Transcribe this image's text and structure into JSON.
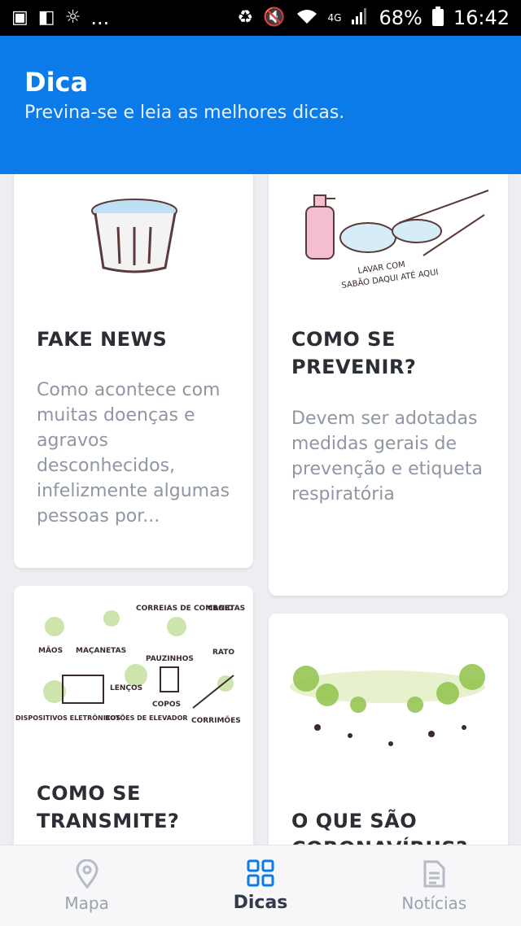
{
  "status_bar": {
    "battery": "68%",
    "time": "16:42",
    "network": "4G",
    "overflow": "..."
  },
  "header": {
    "title": "Dica",
    "subtitle": "Previna-se e leia as melhores dicas."
  },
  "cards": [
    {
      "title": "FAKE NEWS",
      "description": "Como acontece com muitas doenças e agravos desconhecidos, infelizmente algumas pessoas por..."
    },
    {
      "title": "COMO SE PREVENIR?",
      "description": "Devem ser adotadas medidas gerais de prevenção e etiqueta respiratória",
      "image_labels": [
        "LAVAR COM",
        "SABÃO DAQUI ATÉ AQUI"
      ]
    },
    {
      "title": "COMO SE TRANSMITE?",
      "image_labels": [
        "MÃOS",
        "MAÇANETAS",
        "CORREIAS DE COMBOIO",
        "CANETAS",
        "PAUZINHOS",
        "RATO",
        "LENÇOS",
        "COPOS",
        "DISPOSITIVOS ELETRÔNICOS",
        "BOTÕES DE ELEVADOR",
        "CORRIMÕES"
      ]
    },
    {
      "title": "O QUE SÃO CORONAVÍRUS?"
    }
  ],
  "nav": [
    {
      "label": "Mapa",
      "icon": "map-pin-icon"
    },
    {
      "label": "Dicas",
      "icon": "grid-icon",
      "active": true
    },
    {
      "label": "Notícias",
      "icon": "document-icon"
    }
  ],
  "colors": {
    "primary": "#0a7be8",
    "active_nav": "#0a7be8"
  }
}
